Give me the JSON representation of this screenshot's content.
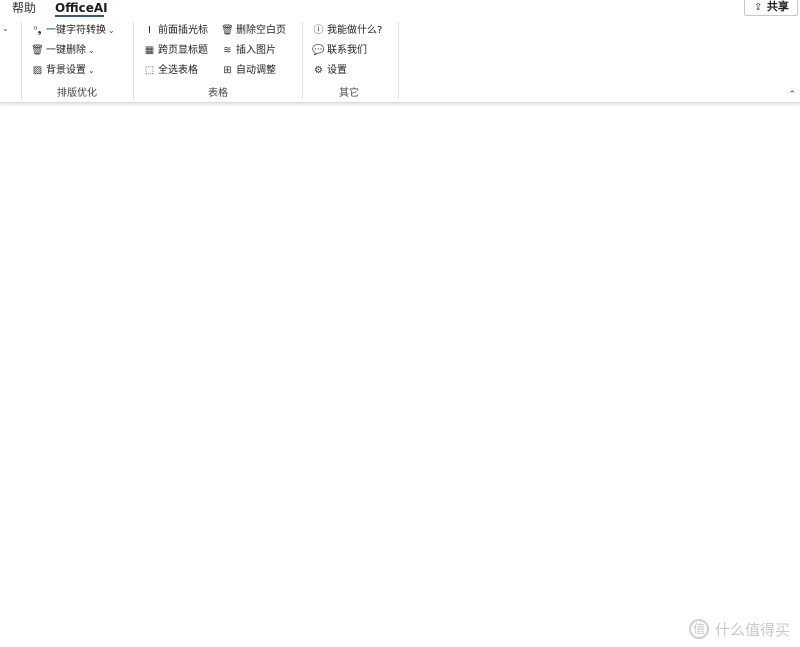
{
  "tabs": {
    "help": "帮助",
    "officeai": "OfficeAI"
  },
  "share": {
    "label": "共享"
  },
  "groups": {
    "layout": {
      "label": "排版优化",
      "items": [
        {
          "label": "一键字符转换",
          "icon": "quote-convert-icon"
        },
        {
          "label": "一键删除",
          "icon": "trash-icon"
        },
        {
          "label": "背景设置",
          "icon": "background-pattern-icon"
        }
      ]
    },
    "table": {
      "label": "表格",
      "items": [
        {
          "label": "前面插光标",
          "icon": "text-cursor-icon"
        },
        {
          "label": "删除空白页",
          "icon": "trash-icon"
        },
        {
          "label": "跨页显标题",
          "icon": "table-header-icon"
        },
        {
          "label": "插入图片",
          "icon": "layers-icon"
        },
        {
          "label": "全选表格",
          "icon": "select-all-icon"
        },
        {
          "label": "自动调整",
          "icon": "table-grid-icon"
        }
      ]
    },
    "other": {
      "label": "其它",
      "items": [
        {
          "label": "我能做什么?",
          "icon": "info-icon"
        },
        {
          "label": "联系我们",
          "icon": "chat-icon"
        },
        {
          "label": "设置",
          "icon": "settings-icon"
        }
      ]
    }
  },
  "watermark": {
    "text": "什么值得买",
    "logo": "值"
  }
}
